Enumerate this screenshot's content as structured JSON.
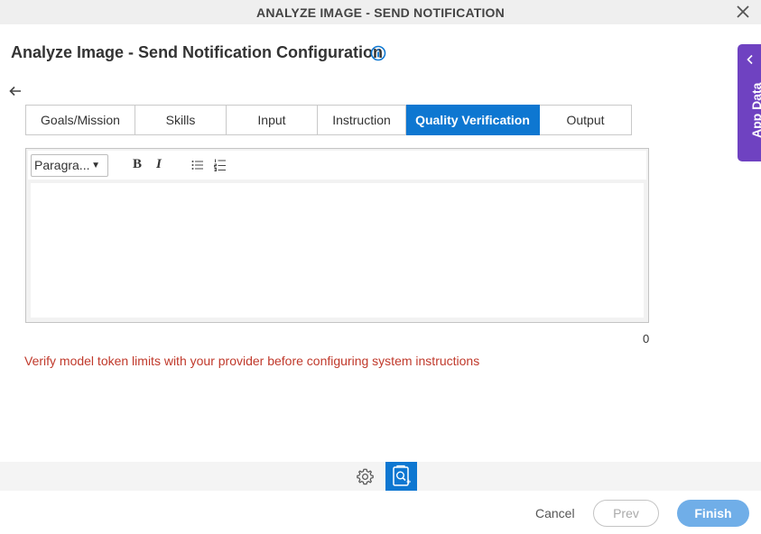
{
  "window": {
    "title": "ANALYZE IMAGE - SEND NOTIFICATION",
    "close_icon": "close-icon"
  },
  "page": {
    "heading": "Analyze Image - Send Notification Configuration",
    "info_icon": "info-icon",
    "back_icon": "arrow-left-icon"
  },
  "tabs": [
    {
      "label": "Goals/Mission",
      "active": false
    },
    {
      "label": "Skills",
      "active": false
    },
    {
      "label": "Input",
      "active": false
    },
    {
      "label": "Instruction",
      "active": false
    },
    {
      "label": "Quality Verification",
      "active": true
    },
    {
      "label": "Output",
      "active": false
    }
  ],
  "editor": {
    "format_select": "Paragra...",
    "bold_label": "B",
    "italic_label": "I",
    "bullet_list_icon": "bullet-list-icon",
    "numbered_list_icon": "numbered-list-icon",
    "content": ""
  },
  "char_count": "0",
  "warning": "Verify model token limits with your provider before configuring system instructions",
  "app_data": {
    "label": "App Data",
    "chevron_icon": "chevron-left-icon"
  },
  "bottom_toolbar": {
    "settings_icon": "gear-icon",
    "analyze_icon": "image-analyze-icon"
  },
  "footer": {
    "cancel_label": "Cancel",
    "prev_label": "Prev",
    "finish_label": "Finish"
  },
  "colors": {
    "primary": "#0e77d1",
    "app_data": "#6f42c1",
    "warning": "#c0392b",
    "finish_disabled": "#70aee8"
  }
}
